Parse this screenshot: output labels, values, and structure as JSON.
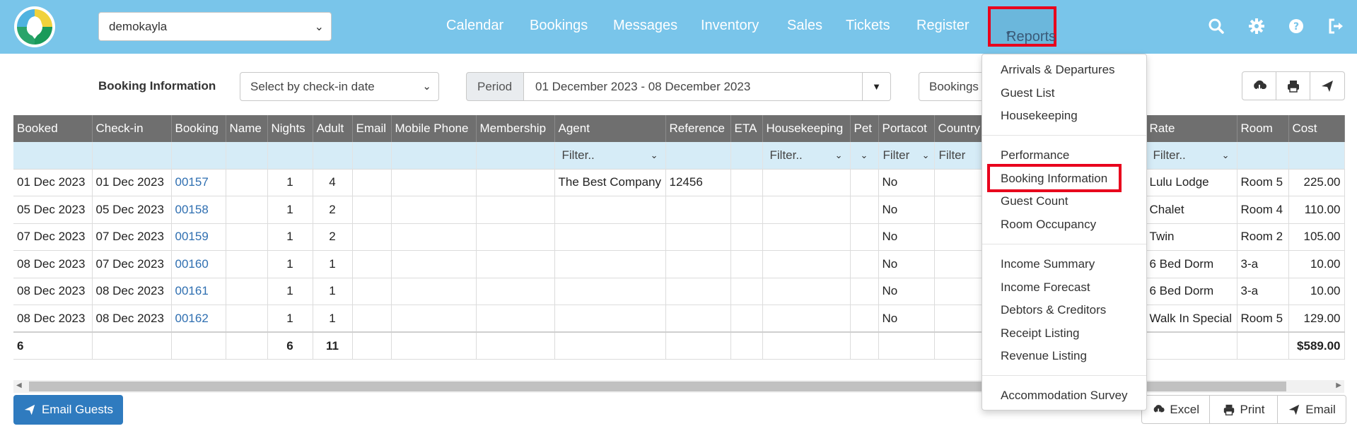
{
  "header": {
    "property_selected": "demokayla",
    "nav": [
      "Calendar",
      "Bookings",
      "Messages",
      "Inventory",
      "Sales",
      "Tickets",
      "Register"
    ],
    "reports_label": "Reports",
    "icons": [
      "search-icon",
      "gear-icon",
      "help-icon",
      "logout-icon"
    ]
  },
  "controls": {
    "report_title": "Booking Information",
    "date_mode": "Select by check-in date",
    "period_label": "Period",
    "period_value": "01 December 2023 - 08 December 2023",
    "bookings_select": "Bookings"
  },
  "table": {
    "columns": [
      "Booked",
      "Check-in",
      "Booking",
      "Name",
      "Nights",
      "Adult",
      "Email",
      "Mobile Phone",
      "Membership",
      "Agent",
      "Reference",
      "ETA",
      "Housekeeping",
      "Pet",
      "Portacot",
      "Country",
      "",
      "",
      "",
      "",
      "Rate",
      "Room",
      "Cost"
    ],
    "filters": {
      "agent": "Filter..",
      "housekeeping": "Filter..",
      "portacot": "Filter",
      "country": "Filter",
      "rate": "Filter.."
    },
    "rows": [
      {
        "booked": "01 Dec 2023",
        "checkin": "01 Dec 2023",
        "booking": "00157",
        "nights": "1",
        "adult": "4",
        "agent": "The Best Company",
        "reference": "12456",
        "portacot": "No",
        "rate": "Lulu Lodge",
        "room": "Room 5",
        "cost": "225.00"
      },
      {
        "booked": "05 Dec 2023",
        "checkin": "05 Dec 2023",
        "booking": "00158",
        "nights": "1",
        "adult": "2",
        "agent": "",
        "reference": "",
        "portacot": "No",
        "rate": "Chalet",
        "room": "Room 4",
        "cost": "110.00"
      },
      {
        "booked": "07 Dec 2023",
        "checkin": "07 Dec 2023",
        "booking": "00159",
        "nights": "1",
        "adult": "2",
        "agent": "",
        "reference": "",
        "portacot": "No",
        "rate": "Twin",
        "room": "Room 2",
        "cost": "105.00"
      },
      {
        "booked": "08 Dec 2023",
        "checkin": "07 Dec 2023",
        "booking": "00160",
        "nights": "1",
        "adult": "1",
        "agent": "",
        "reference": "",
        "portacot": "No",
        "rate": "6 Bed Dorm",
        "room": "3-a",
        "cost": "10.00"
      },
      {
        "booked": "08 Dec 2023",
        "checkin": "08 Dec 2023",
        "booking": "00161",
        "nights": "1",
        "adult": "1",
        "agent": "",
        "reference": "",
        "portacot": "No",
        "rate": "6 Bed Dorm",
        "room": "3-a",
        "cost": "10.00"
      },
      {
        "booked": "08 Dec 2023",
        "checkin": "08 Dec 2023",
        "booking": "00162",
        "nights": "1",
        "adult": "1",
        "agent": "",
        "reference": "",
        "portacot": "No",
        "rate": "Walk In Special",
        "room": "Room 5",
        "cost": "129.00"
      }
    ],
    "totals": {
      "booked": "6",
      "nights": "6",
      "adult": "11",
      "cost": "$589.00"
    }
  },
  "footer": {
    "email_guests": "Email Guests",
    "excel": "Excel",
    "print": "Print",
    "email": "Email"
  },
  "reports_menu": {
    "group1": [
      "Arrivals & Departures",
      "Guest List",
      "Housekeeping"
    ],
    "group2": [
      "Performance",
      "Booking Information",
      "Guest Count",
      "Room Occupancy"
    ],
    "group3": [
      "Income Summary",
      "Income Forecast",
      "Debtors & Creditors",
      "Receipt Listing",
      "Revenue Listing"
    ],
    "group4": [
      "Accommodation Survey"
    ],
    "highlighted": "Booking Information"
  },
  "colors": {
    "topbar": "#79c5ea",
    "header_row": "#6f6f6f",
    "filter_row": "#d6ecf7",
    "link": "#2f6fb1",
    "primary_button": "#2f7bbf",
    "highlight_border": "#e8001c"
  }
}
